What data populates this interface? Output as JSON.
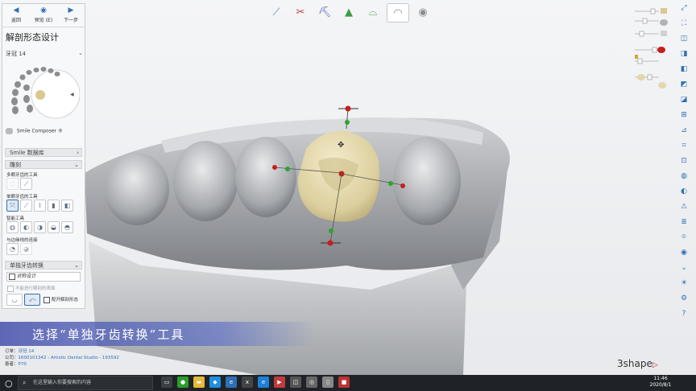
{
  "nav": {
    "back": "返回",
    "preview": "预览 (E)",
    "next": "下一步"
  },
  "panel": {
    "title": "解剖形态设计",
    "tooth": "牙冠 14",
    "smile_composer": "Smile Composer ®",
    "library_header": "Smile 数据库",
    "anatomy_header": "雕刻",
    "multi_tool_label": "多颗牙齿的工具",
    "single_tool_label": "单颗牙齿的工具",
    "smart_tool_label": "智能工具",
    "morph_tool_label": "与边缘线的连接",
    "transform_header": "单独牙齿转换",
    "checkbox_label": "对称设计",
    "disabled_label": "不能进行颗别的表面",
    "bottom_check_label": "配开解剖形态"
  },
  "toolbar": {
    "items": [
      "margin",
      "scissors",
      "shovel",
      "cone",
      "tray",
      "tooth",
      "sphere"
    ]
  },
  "banner": {
    "text": "选择“单独牙齿转换”工具"
  },
  "info": {
    "order_label": "订单：",
    "order_value": "牙冠 14",
    "company_label": "公司：",
    "company_value": "1600101342 - Artistic Dental Studio - 193592",
    "patient_label": "患者：",
    "patient_value": "P70"
  },
  "brand": {
    "logo": "3shape"
  },
  "taskbar": {
    "search_placeholder": "在这里输入你要搜索的内容",
    "time": "11:46",
    "date": "2020/8/1"
  },
  "colors": {
    "accent": "#2f6fb5",
    "crown": "#e3d7ad",
    "model": "#a7aaae",
    "handle_red": "#c4201b",
    "handle_green": "#2aa52a"
  }
}
